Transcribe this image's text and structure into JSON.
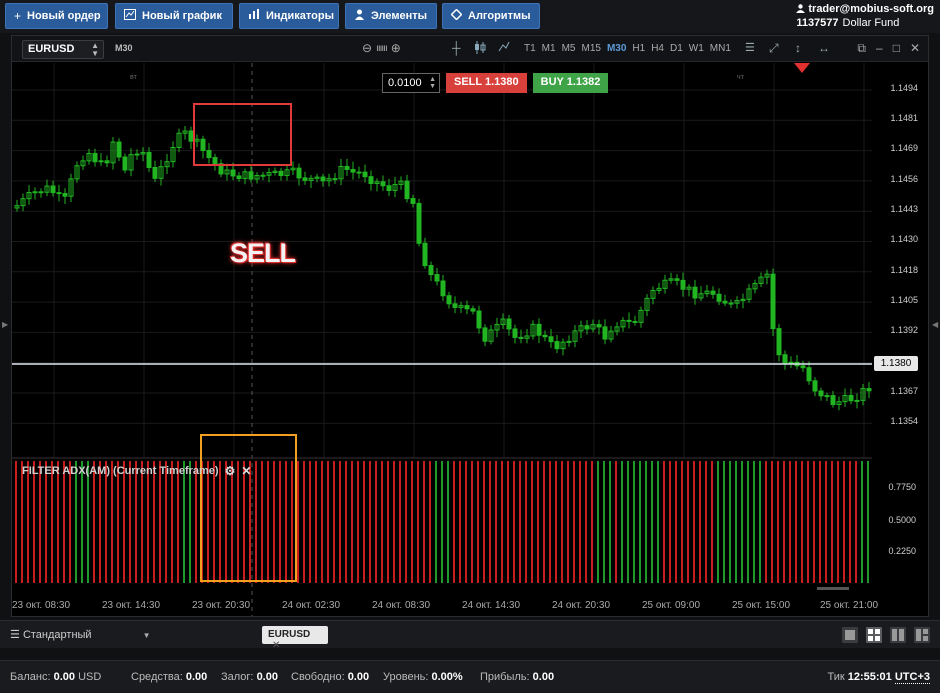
{
  "toolbar": {
    "new_order": "Новый ордер",
    "new_chart": "Новый график",
    "indicators": "Индикаторы",
    "elements": "Элементы",
    "algorithms": "Алгоритмы"
  },
  "account": {
    "user": "trader@mobius-soft.org",
    "id": "1137577",
    "fund": "Dollar Fund"
  },
  "chart": {
    "symbol": "EURUSD",
    "timeframe": "M30",
    "timeframes": [
      "T1",
      "M1",
      "M5",
      "M15",
      "M30",
      "H1",
      "H4",
      "D1",
      "W1",
      "MN1"
    ],
    "active_timeframe": "M30",
    "lot": "0.0100",
    "sell_label": "SELL 1.1380",
    "buy_label": "BUY 1.1382",
    "current_price": "1.1380",
    "price_labels": [
      "1.1494",
      "1.1481",
      "1.1469",
      "1.1456",
      "1.1443",
      "1.1430",
      "1.1418",
      "1.1405",
      "1.1392",
      "1.1367",
      "1.1354"
    ],
    "day_labels": [
      "вт",
      "чт"
    ],
    "annotation": "SELL",
    "indicator_title": "FILTER ADX(AM) (Current Timeframe)",
    "indicator_levels": [
      "0.7750",
      "0.5000",
      "0.2250"
    ],
    "time_labels": [
      "23 окт. 08:30",
      "23 окт. 14:30",
      "23 окт. 20:30",
      "24 окт. 02:30",
      "24 окт. 08:30",
      "24 окт. 14:30",
      "24 окт. 20:30",
      "25 окт. 09:00",
      "25 окт. 15:00",
      "25 окт. 21:00"
    ],
    "colors": {
      "up": "#22b522",
      "sell": "#d8403c",
      "buy": "#3fa347",
      "hist_red": "#c81e1e",
      "hist_green": "#1e9a2a",
      "box_red": "#e03a3a",
      "box_orange": "#f2a020"
    }
  },
  "tabs": {
    "layout": "Стандартный",
    "doc_tab": "EURUSD"
  },
  "status": {
    "balance_label": "Баланс:",
    "balance_value": "0.00",
    "balance_currency": "USD",
    "equity_label": "Средства:",
    "equity_value": "0.00",
    "margin_label": "Залог:",
    "margin_value": "0.00",
    "free_label": "Свободно:",
    "free_value": "0.00",
    "level_label": "Уровень:",
    "level_value": "0.00%",
    "profit_label": "Прибыль:",
    "profit_value": "0.00",
    "tick_label": "Тик",
    "time": "12:55:01",
    "tz": "UTC+3"
  }
}
